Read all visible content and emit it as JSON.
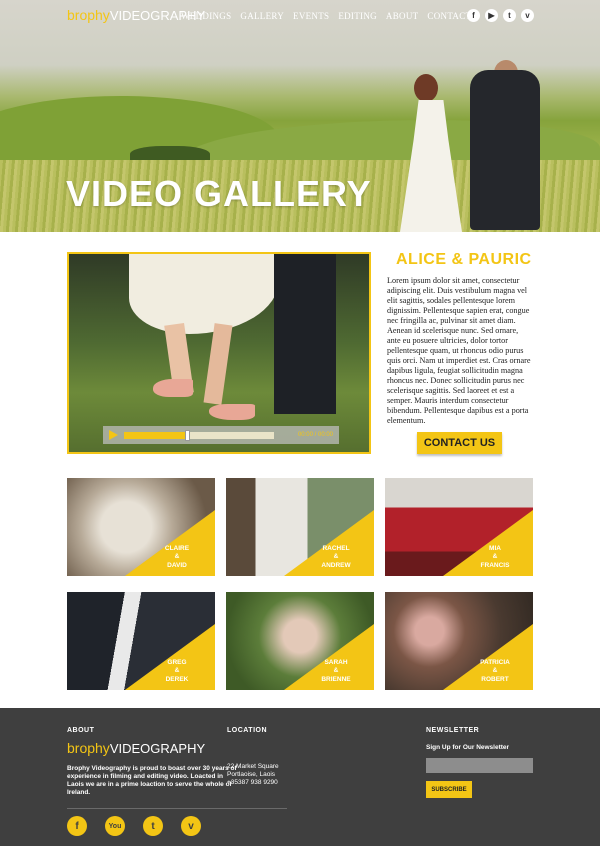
{
  "header": {
    "logo_brand": "brophy",
    "logo_rest": "VIDEOGRAPHY",
    "nav": [
      "WEDDINGS",
      "GALLERY",
      "EVENTS",
      "EDITING",
      "ABOUT",
      "CONTACT"
    ],
    "social_icons": [
      "f",
      "▶",
      "t",
      "v"
    ]
  },
  "hero": {
    "title": "VIDEO GALLERY"
  },
  "feature": {
    "title": "ALICE & PAURIC",
    "text": "Lorem ipsum dolor sit amet, consectetur adipiscing elit. Duis vestibulum magna vel elit sagittis, sodales pellentesque lorem dignissim. Pellentesque sapien erat, congue nec fringilla ac, pulvinar sit amet diam. Aenean id scelerisque nunc. Sed ornare, ante eu posuere ultricies, dolor tortor pellentesque quam, ut rhoncus odio purus quis orci. Nam ut imperdiet est. Cras ornare dapibus ligula, feugiat sollicitudin magna rhoncus nec. Donec sollicitudin purus nec scelerisque sagittis. Sed laoreet et est a semper. Mauris interdum consectetur bibendum. Pellentesque dapibus est a porta elementum.",
    "button": "CONTACT US",
    "video_progress": 0.42,
    "video_time": "00:00 / 00:00"
  },
  "gallery": [
    {
      "line1": "CLAIRE",
      "amp": "&",
      "line2": "DAVID"
    },
    {
      "line1": "RACHEL",
      "amp": "&",
      "line2": "ANDREW"
    },
    {
      "line1": "MIA",
      "amp": "&",
      "line2": "FRANCIS"
    },
    {
      "line1": "GREG",
      "amp": "&",
      "line2": "DEREK"
    },
    {
      "line1": "SARAH",
      "amp": "&",
      "line2": "BRIENNE"
    },
    {
      "line1": "PATRICIA",
      "amp": "&",
      "line2": "ROBERT"
    }
  ],
  "footer": {
    "about_head": "ABOUT",
    "about_text": "Brophy Videography is proud to boast over 30 years of experience in filming and editing video. Loacted in Laois we are in a prime loaction to serve the whole of Ireland.",
    "location_head": "LOCATION",
    "address_line1": "22 Market Square",
    "address_line2": "Portlaoise, Laois",
    "address_line3": "+35387 938 9290",
    "newsletter_head": "NEWSLETTER",
    "newsletter_label": "Sign Up for Our Newsletter",
    "subscribe": "SUBSCRIBE",
    "social_icons": [
      "f",
      "You",
      "t",
      "v"
    ]
  },
  "colors": {
    "accent": "#f3c515",
    "footer_bg": "#3f3f3f"
  }
}
